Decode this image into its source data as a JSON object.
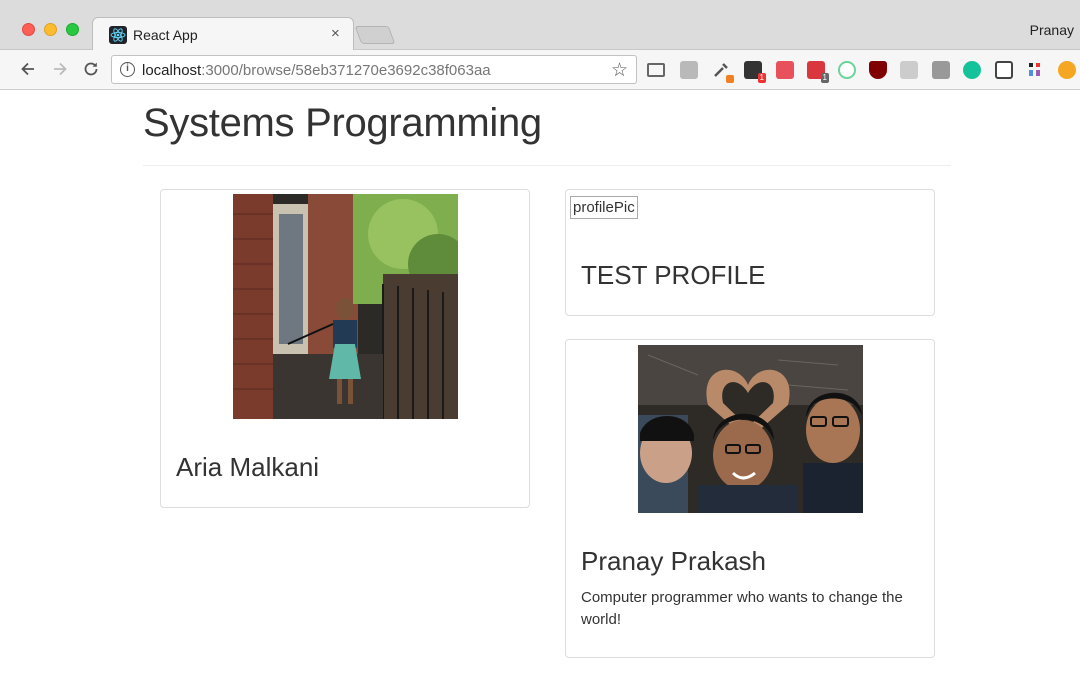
{
  "browser": {
    "tab_title": "React App",
    "tab_close": "×",
    "profile_name": "Pranay",
    "url_host": "localhost",
    "url_path": ":3000/browse/58eb371270e3692c38f063aa"
  },
  "page": {
    "title": "Systems Programming"
  },
  "cards": [
    {
      "name": "Aria Malkani",
      "description": "",
      "image_alt": ""
    },
    {
      "name": "TEST PROFILE",
      "description": "",
      "image_alt": "profilePic"
    },
    {
      "name": "Pranay Prakash",
      "description": "Computer programmer who wants to change the world!",
      "image_alt": ""
    }
  ],
  "extensions": {
    "badge_red": "1",
    "badge_grey": "1"
  }
}
